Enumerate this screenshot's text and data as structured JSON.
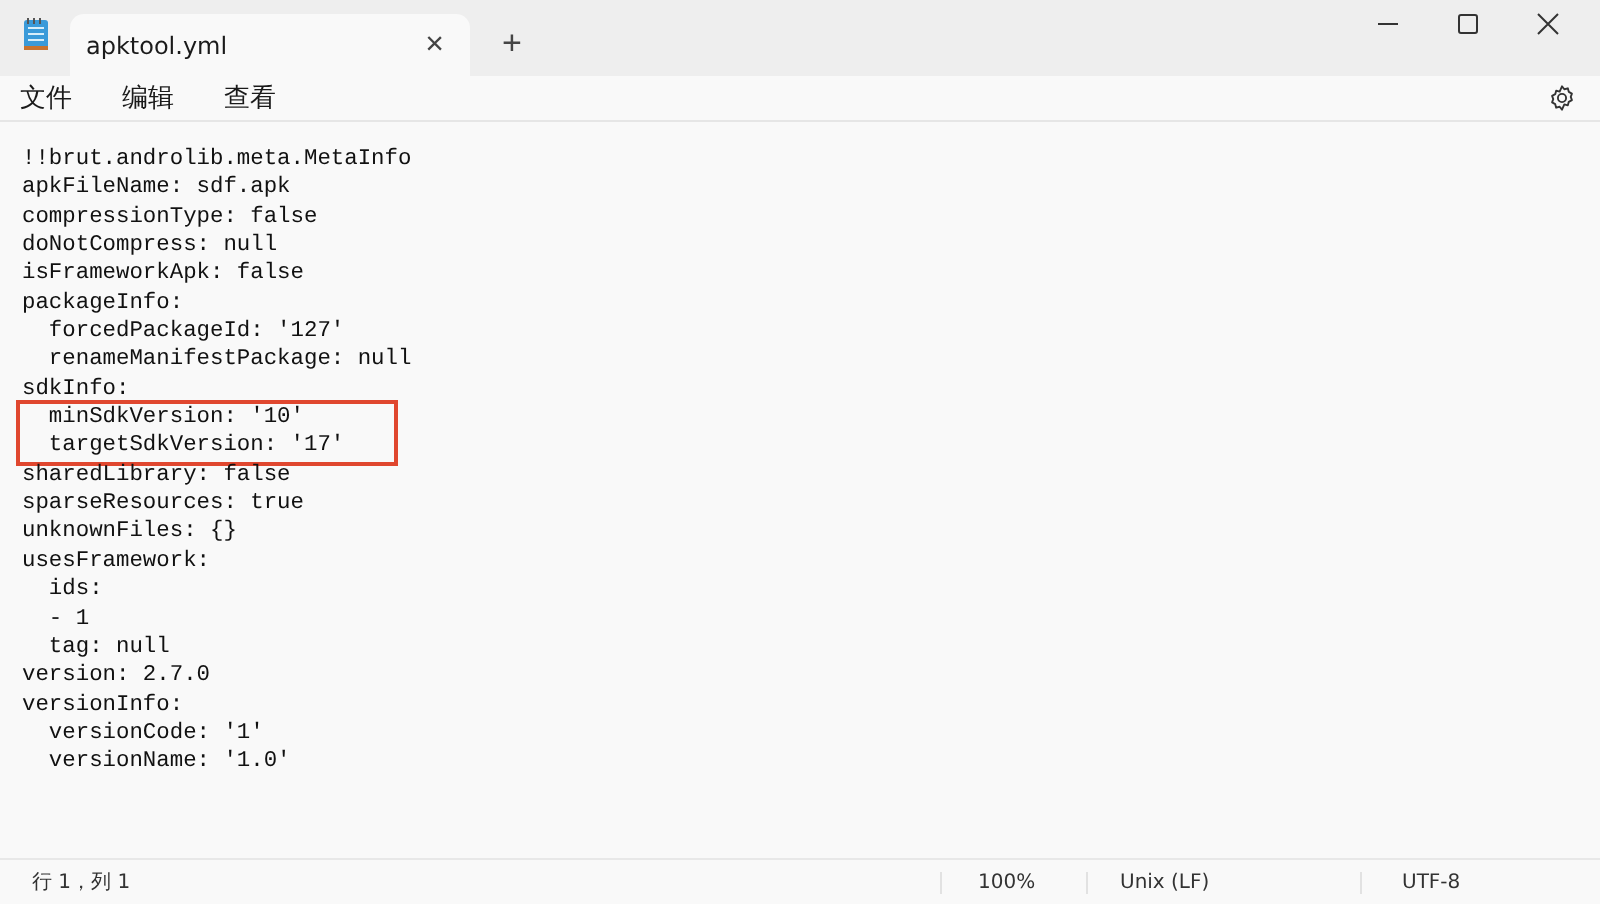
{
  "window": {
    "tab": {
      "title": "apktool.yml",
      "close": "×"
    },
    "new_tab": "+"
  },
  "menu": [
    {
      "label": "文件"
    },
    {
      "label": "编辑"
    },
    {
      "label": "查看"
    }
  ],
  "editor": {
    "blocks": [
      {
        "kind": "plain",
        "lines": [
          "!!brut.androlib.meta.MetaInfo",
          "apkFileName: sdf.apk",
          "compressionType: false",
          "doNotCompress: null",
          "isFrameworkApk: false",
          "packageInfo:",
          "  forcedPackageId: '127'",
          "  renameManifestPackage: null",
          "sdkInfo:"
        ]
      },
      {
        "kind": "boxed",
        "lines": [
          "  minSdkVersion: '10'",
          "  targetSdkVersion: '17'"
        ]
      },
      {
        "kind": "plain",
        "lines": [
          "sharedLibrary: false",
          "sparseResources: true",
          "unknownFiles: {}",
          "usesFramework:",
          "  ids:",
          "  - 1",
          "  tag: null",
          "version: 2.7.0",
          "versionInfo:",
          "  versionCode: '1'",
          "  versionName: '1.0'"
        ]
      }
    ]
  },
  "status_bar": {
    "position": "行 1，列 1",
    "zoom": "100%",
    "line_ending": "Unix (LF)",
    "encoding": "UTF-8"
  }
}
